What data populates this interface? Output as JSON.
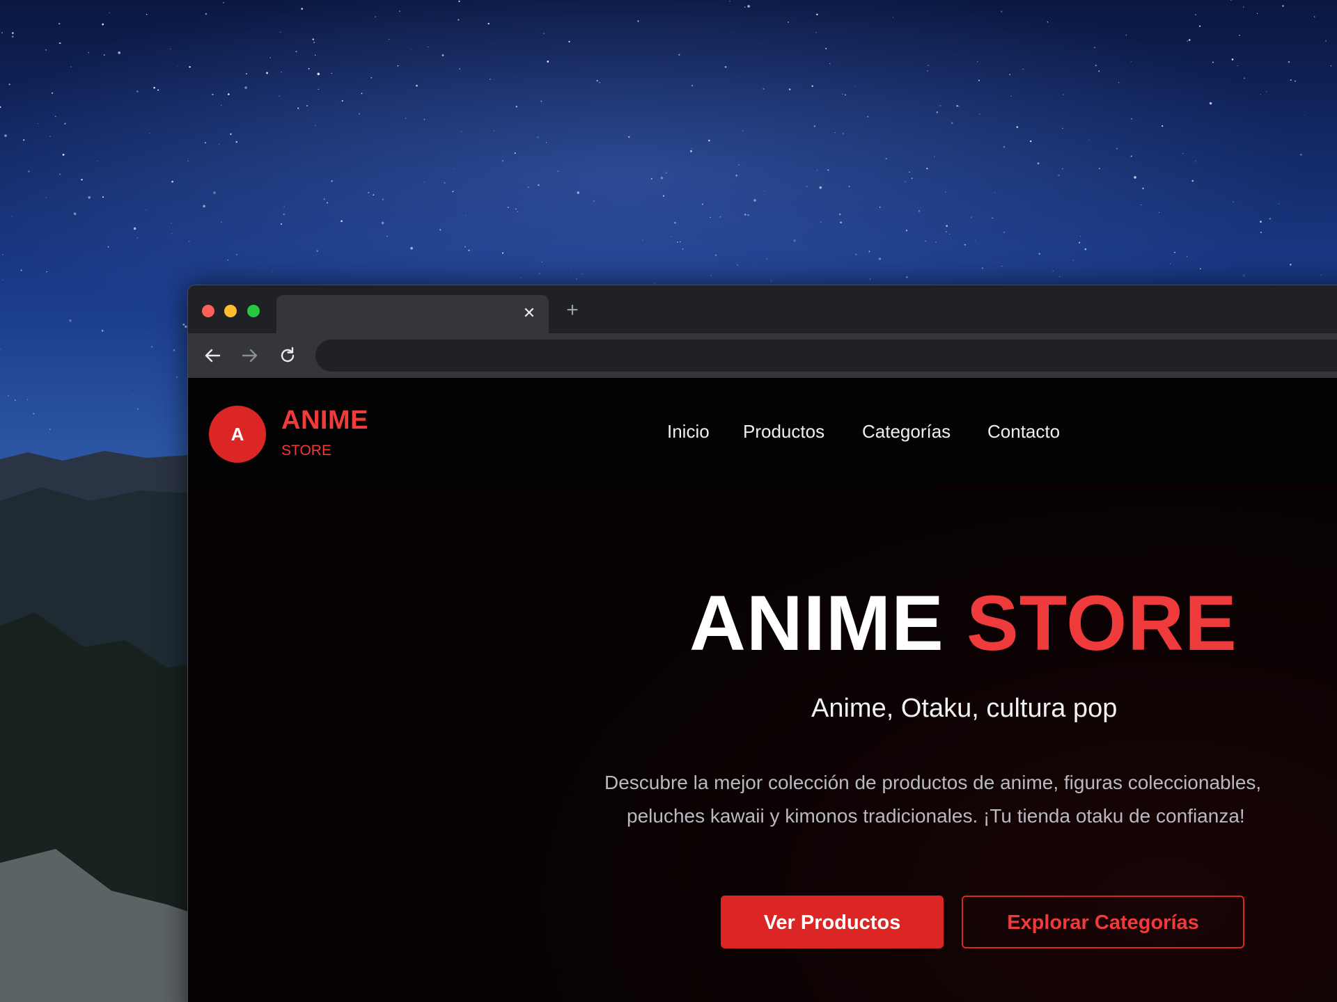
{
  "browser": {
    "tab_title": "",
    "address": "",
    "close_icon": "close-icon",
    "new_tab_icon": "plus-icon"
  },
  "site": {
    "logo_letter": "A",
    "logo_title": "ANIME",
    "logo_subtitle": "STORE",
    "nav": [
      "Inicio",
      "Productos",
      "Categorías",
      "Contacto"
    ]
  },
  "hero": {
    "title_white": "ANIME",
    "title_red": "STORE",
    "subtitle": "Anime, Otaku, cultura pop",
    "description_line1": "Descubre la mejor colección de productos de anime, figuras coleccionables,",
    "description_line2": "peluches kawaii y kimonos tradicionales. ¡Tu tienda otaku de confianza!",
    "primary_button": "Ver Productos",
    "secondary_button": "Explorar Categorías"
  },
  "colors": {
    "accent": "#dc2626",
    "accent_text": "#ef3b3b",
    "page_bg": "#000000"
  }
}
